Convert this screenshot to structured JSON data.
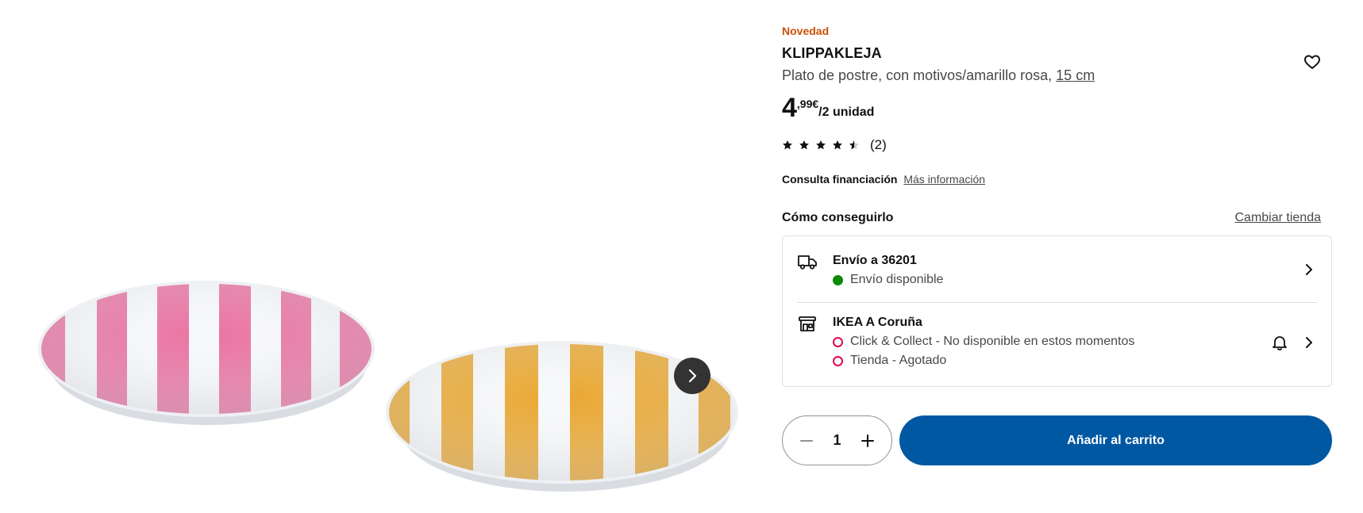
{
  "product": {
    "badge": "Novedad",
    "name": "KLIPPAKLEJA",
    "description": "Plato de postre, con motivos/amarillo rosa,",
    "size_link": "15 cm",
    "price": {
      "integer": "4",
      "decimals": ",99€",
      "unit": "/2 unidad"
    },
    "rating": {
      "value": 4.5,
      "max": 5,
      "count_label": "(2)"
    },
    "favorite_icon": "heart-outline-icon"
  },
  "gallery": {
    "next_icon": "chevron-right-icon",
    "images": [
      {
        "name": "pink-striped-plate",
        "stripe_color": "#e8679a"
      },
      {
        "name": "yellow-striped-plate",
        "stripe_color": "#e8a326"
      }
    ]
  },
  "finance": {
    "label": "Consulta financiación",
    "link": "Más información"
  },
  "availability": {
    "heading": "Cómo conseguirlo",
    "change_store": "Cambiar tienda",
    "delivery": {
      "title": "Envío a 36201",
      "status": "Envío disponible",
      "status_color": "#0a8a00"
    },
    "store": {
      "title": "IKEA A Coruña",
      "click_collect": "Click & Collect - No disponible en estos momentos",
      "in_store": "Tienda - Agotado",
      "status_color": "#e00751"
    }
  },
  "cart": {
    "quantity": "1",
    "add_label": "Añadir al carrito",
    "accent": "#0058a3"
  }
}
